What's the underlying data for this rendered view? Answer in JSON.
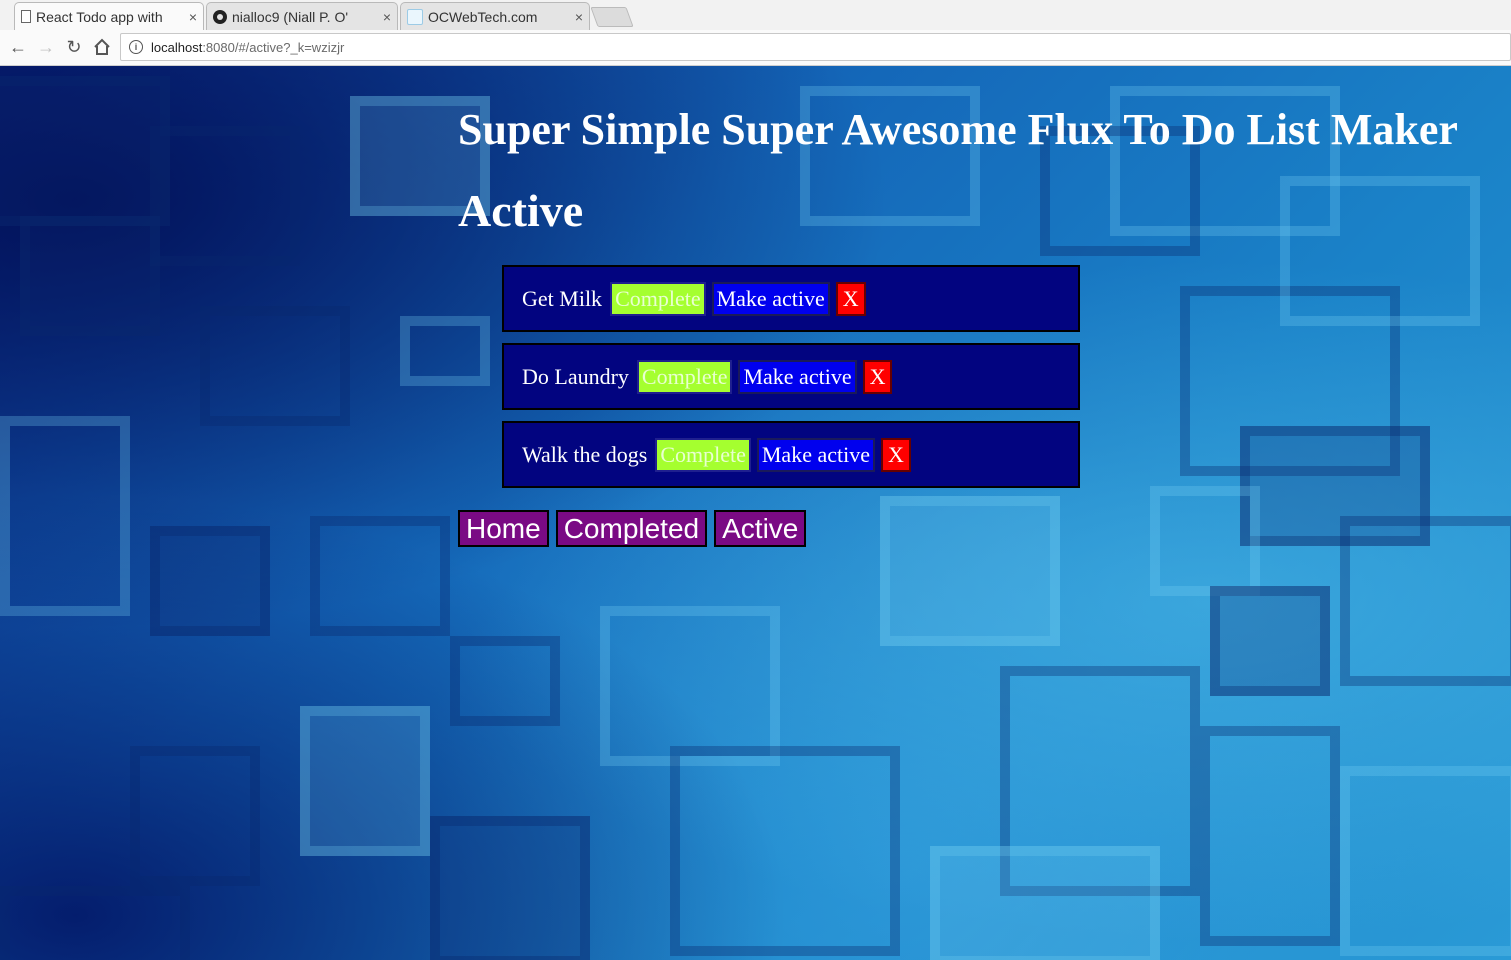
{
  "browser": {
    "tabs": [
      {
        "label": "React Todo app with",
        "icon": "document-icon",
        "active": true
      },
      {
        "label": "nialloc9 (Niall P. O'",
        "icon": "github-icon",
        "active": false
      },
      {
        "label": "OCWebTech.com",
        "icon": "ocwebtech-icon",
        "active": false
      }
    ],
    "close_glyph": "×",
    "url_host": "localhost",
    "url_rest": ":8080/#/active?_k=wzizjr"
  },
  "app": {
    "title": "Super Simple Super Awesome Flux To Do List Maker",
    "view_title": "Active",
    "todos": [
      {
        "text": "Get Milk",
        "complete_label": "Complete",
        "active_label": "Make active",
        "delete_label": "X"
      },
      {
        "text": "Do Laundry",
        "complete_label": "Complete",
        "active_label": "Make active",
        "delete_label": "X"
      },
      {
        "text": "Walk the dogs",
        "complete_label": "Complete",
        "active_label": "Make active",
        "delete_label": "X"
      }
    ],
    "nav": {
      "home": "Home",
      "completed": "Completed",
      "active": "Active"
    }
  },
  "colors": {
    "todo_bg": "#020480",
    "complete_bg": "#a5ff2f",
    "make_active_bg": "#0000ee",
    "delete_bg": "#ff0000",
    "nav_bg": "#7a0a84"
  }
}
